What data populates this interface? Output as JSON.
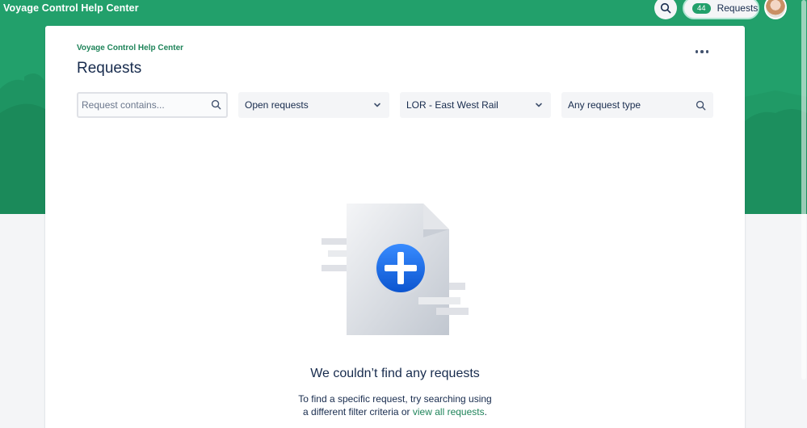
{
  "header": {
    "site_title": "Voyage Control Help Center",
    "requests_count": "44",
    "requests_label": "Requests"
  },
  "card": {
    "breadcrumb": "Voyage Control Help Center",
    "title": "Requests"
  },
  "filters": {
    "search_placeholder": "Request contains...",
    "status_value": "Open requests",
    "organization_value": "LOR - East West Rail",
    "request_type_value": "Any request type"
  },
  "empty_state": {
    "title": "We couldn’t find any requests",
    "description_line1": "To find a specific request, try searching using",
    "description_line2_prefix": "a different filter criteria or",
    "link_label": "view all requests",
    "description_line2_suffix": "."
  },
  "icons": {
    "search": "search-icon",
    "chevron": "chevron-down-icon",
    "more": "more-icon",
    "avatar": "user-avatar",
    "illustration": "empty-requests-illustration"
  },
  "colors": {
    "brand_green": "#22a06b",
    "link_green": "#1f845a",
    "text": "#172b4d",
    "plus_blue": "#0c66e4"
  }
}
